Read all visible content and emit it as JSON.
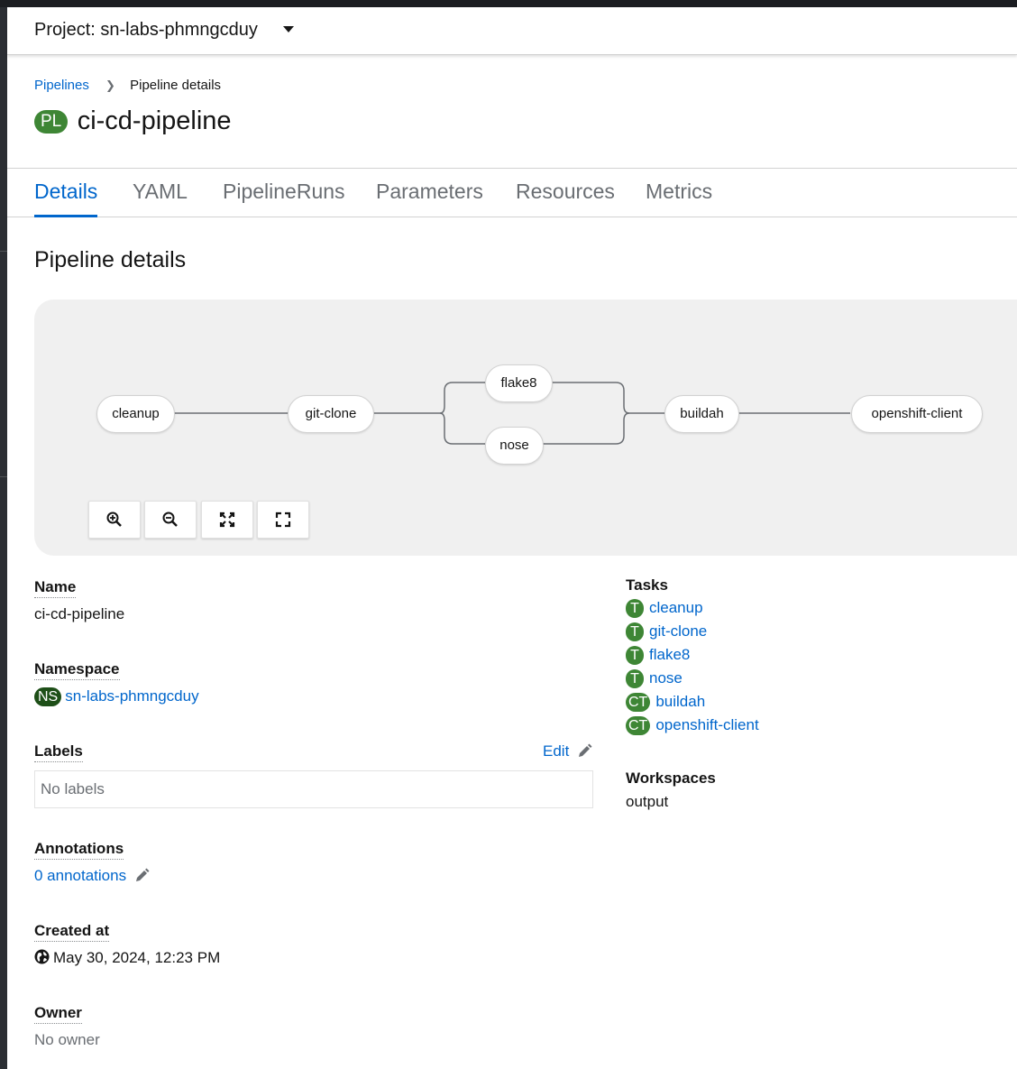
{
  "project": {
    "label": "Project: sn-labs-phmngcduy"
  },
  "breadcrumb": {
    "parent": "Pipelines",
    "current": "Pipeline details"
  },
  "header": {
    "badge": "PL",
    "title": "ci-cd-pipeline"
  },
  "tabs": [
    {
      "label": "Details",
      "active": true
    },
    {
      "label": "YAML"
    },
    {
      "label": "PipelineRuns"
    },
    {
      "label": "Parameters"
    },
    {
      "label": "Resources"
    },
    {
      "label": "Metrics"
    }
  ],
  "section_title": "Pipeline details",
  "graph": {
    "nodes": [
      "cleanup",
      "git-clone",
      "flake8",
      "nose",
      "buildah",
      "openshift-client"
    ],
    "controls": [
      "zoom-in-icon",
      "zoom-out-icon",
      "fit-to-screen-icon",
      "reset-view-icon"
    ]
  },
  "details": {
    "name_label": "Name",
    "name_value": "ci-cd-pipeline",
    "namespace_label": "Namespace",
    "namespace_badge": "NS",
    "namespace_value": "sn-labs-phmngcduy",
    "labels_label": "Labels",
    "labels_edit": "Edit",
    "labels_value": "No labels",
    "annotations_label": "Annotations",
    "annotations_value": "0 annotations",
    "created_label": "Created at",
    "created_value": "May 30, 2024, 12:23 PM",
    "owner_label": "Owner",
    "owner_value": "No owner"
  },
  "tasks": {
    "label": "Tasks",
    "items": [
      {
        "badge": "T",
        "name": "cleanup"
      },
      {
        "badge": "T",
        "name": "git-clone"
      },
      {
        "badge": "T",
        "name": "flake8"
      },
      {
        "badge": "T",
        "name": "nose"
      },
      {
        "badge": "CT",
        "name": "buildah"
      },
      {
        "badge": "CT",
        "name": "openshift-client"
      }
    ]
  },
  "workspaces": {
    "label": "Workspaces",
    "value": "output"
  },
  "colors": {
    "link": "#0066cc",
    "badge_green": "#3e8635",
    "ns_badge": "#1e4f18"
  }
}
